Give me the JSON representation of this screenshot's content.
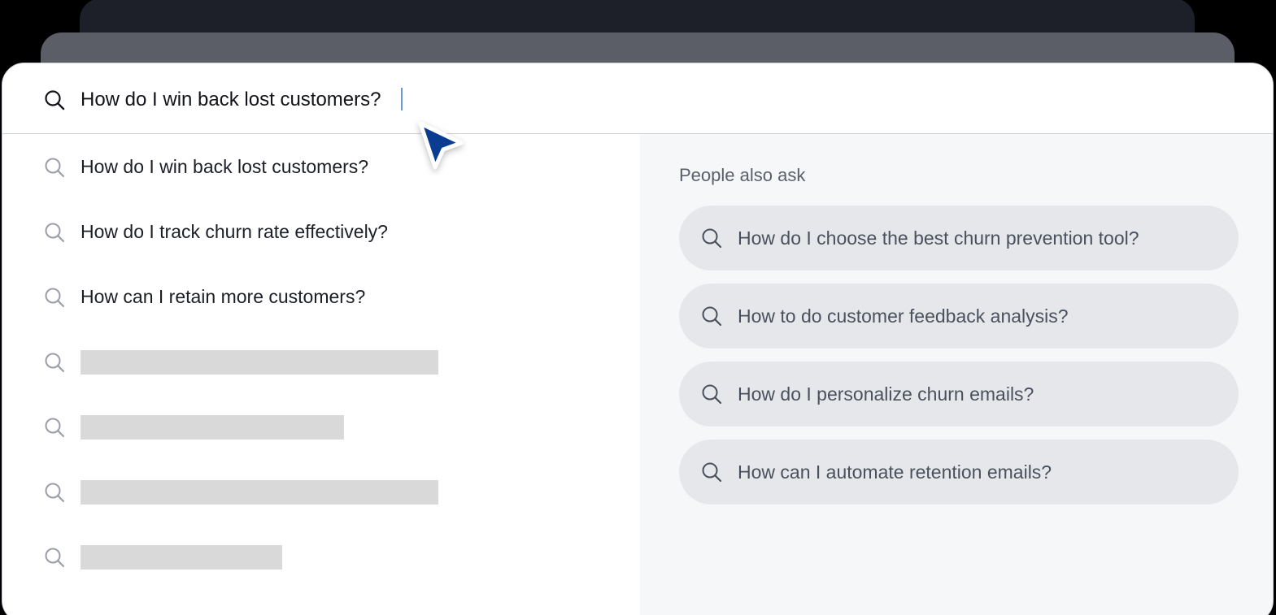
{
  "colors": {
    "accent": "#0a3d91",
    "caret": "#6b96d8",
    "placeholder": "#d9d9d9",
    "pill": "#e5e7eb"
  },
  "search": {
    "value": "How do I win back lost customers?",
    "icon": "search-icon"
  },
  "suggestions": [
    {
      "label": "How do I win back lost customers?",
      "icon": "search-icon"
    },
    {
      "label": "How do I track churn rate effectively?",
      "icon": "search-icon"
    },
    {
      "label": "How can I retain more customers?",
      "icon": "search-icon"
    },
    {
      "label": "",
      "icon": "search-icon"
    },
    {
      "label": "",
      "icon": "search-icon"
    },
    {
      "label": "",
      "icon": "search-icon"
    },
    {
      "label": "",
      "icon": "search-icon"
    }
  ],
  "people_also_ask": {
    "title": "People also ask",
    "items": [
      {
        "label": "How do I choose the best churn prevention tool?",
        "icon": "search-icon"
      },
      {
        "label": "How to do customer feedback analysis?",
        "icon": "search-icon"
      },
      {
        "label": "How do I personalize churn emails?",
        "icon": "search-icon"
      },
      {
        "label": "How can I automate retention emails?",
        "icon": "search-icon"
      }
    ]
  }
}
